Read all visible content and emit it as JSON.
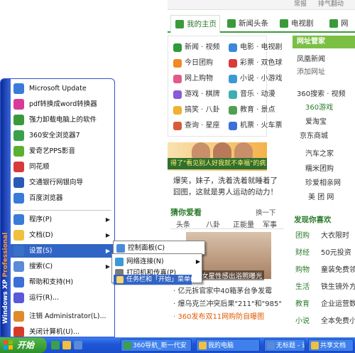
{
  "browser": {
    "top_strip": {
      "left": "常报",
      "right": "排气翻动"
    },
    "tabs": [
      {
        "label": "我的主页",
        "color": "#3a9a3a"
      },
      {
        "label": "新闻头条",
        "color": "#3a9a3a"
      },
      {
        "label": "电视剧",
        "color": "#3a9a3a"
      },
      {
        "label": "网",
        "color": "#3a9a3a"
      }
    ],
    "nav_grid": [
      {
        "label": "新闻 · 视频",
        "color": "#2e9a3a"
      },
      {
        "label": "电影 · 电视剧",
        "color": "#3a88d8"
      },
      {
        "label": "今日团购",
        "color": "#f08a24"
      },
      {
        "label": "彩票 · 双色球",
        "color": "#d93a3a"
      },
      {
        "label": "网上购物",
        "color": "#e25a8a"
      },
      {
        "label": "小说 · 小游戏",
        "color": "#3a9ad8"
      },
      {
        "label": "游戏 · 棋牌",
        "color": "#8a5ad8"
      },
      {
        "label": "音乐 · 动漫",
        "color": "#3ab0b0"
      },
      {
        "label": "搞笑 · 八卦",
        "color": "#f0b030"
      },
      {
        "label": "教育 · 景点",
        "color": "#50a050"
      },
      {
        "label": "查询 · 星座",
        "color": "#d85a3a"
      },
      {
        "label": "机票 · 火车票",
        "color": "#3a70d8"
      }
    ],
    "right_panel": {
      "title": "网址管家",
      "items": [
        "凤凰新闻",
        "添加网址",
        "360搜索 · 视频",
        "360游戏",
        "爱淘宝",
        "京东商城",
        "汽车之家",
        "糯米团购",
        "珍爱相亲网",
        "美 团 网"
      ]
    },
    "banner_caption": "得了\"看见别人好我就不幸福\"的病",
    "news": [
      "爆笑，妹子，洗着洗着就睡着了",
      "囧图，这就是男人运动的动力！"
    ],
    "guess": {
      "title": "猜你爱看",
      "swap": "换一下",
      "tabs": [
        "头条",
        "八卦",
        "正能量",
        "军事"
      ],
      "photo_caption": "女星性感出浴照曝光",
      "list": [
        "· 亿元拆官家中40箱茅台争发霉",
        "· 爆乌克兰冲突后果\"211\"和\"985\"",
        "· 360发布双11网购防自曝图"
      ]
    },
    "found": {
      "title": "发现你喜欢",
      "rows": [
        {
          "cat": "团购",
          "item": "大衣限时"
        },
        {
          "cat": "财经",
          "item": "50元投资"
        },
        {
          "cat": "购物",
          "item": "童装免费领"
        },
        {
          "cat": "生活",
          "item": "铁生镜外方"
        },
        {
          "cat": "教育",
          "item": "企业运营数"
        },
        {
          "cat": "小说",
          "item": "全本免费小"
        }
      ]
    }
  },
  "start_menu": {
    "side_label_prefix": "Windows XP ",
    "side_label_suffix": "Professional",
    "programs": [
      {
        "label": "Microsoft Update",
        "color": "#3a7ad8"
      },
      {
        "label": "pdf转换成word转换器",
        "color": "#d83a9a"
      },
      {
        "label": "强力卸载电脑上的软件",
        "color": "#3a9a3a"
      },
      {
        "label": "360安全浏览器7",
        "color": "#3aa04a"
      },
      {
        "label": "爱奇艺PPS影音",
        "color": "#5ab030"
      },
      {
        "label": "同花顺",
        "color": "#d83a3a"
      },
      {
        "label": "交通银行网银向导",
        "color": "#2a5ab8"
      },
      {
        "label": "百度浏览器",
        "color": "#3a7ad8"
      }
    ],
    "items": [
      {
        "label": "程序(P)",
        "arrow": "▶",
        "color": "#3a7ad8"
      },
      {
        "label": "文档(D)",
        "arrow": "▶",
        "color": "#f0c040"
      },
      {
        "label": "设置(S)",
        "arrow": "▶",
        "color": "#3a70c8"
      },
      {
        "label": "搜索(C)",
        "arrow": "▶",
        "color": "#5a8ad8"
      },
      {
        "label": "帮助和支持(H)",
        "arrow": "",
        "color": "#3a70d8"
      },
      {
        "label": "运行(R)...",
        "arrow": "",
        "color": "#5a5ad8"
      },
      {
        "label": "注销 Administrator(L)...",
        "arrow": "",
        "color": "#e08a2a"
      },
      {
        "label": "关闭计算机(U)...",
        "arrow": "",
        "color": "#d83a2a"
      }
    ]
  },
  "settings_submenu": {
    "control_panel": "控制面板(C)",
    "network": "网络连接(N)",
    "printers": "打印机和传真(P)",
    "taskbar_props": "任务栏和「开始」菜单(T)",
    "arrow": "▶"
  },
  "taskbar": {
    "start_label": "开始",
    "buttons": [
      {
        "label": "360导航_新一代安",
        "color": "#3aa04a"
      },
      {
        "label": "我的电脑",
        "color": "#f0c040"
      },
      {
        "label": "无标题 - 记事本",
        "color": "#5a8ad8"
      },
      {
        "label": "共享文档",
        "color": "#f0c040"
      }
    ]
  }
}
